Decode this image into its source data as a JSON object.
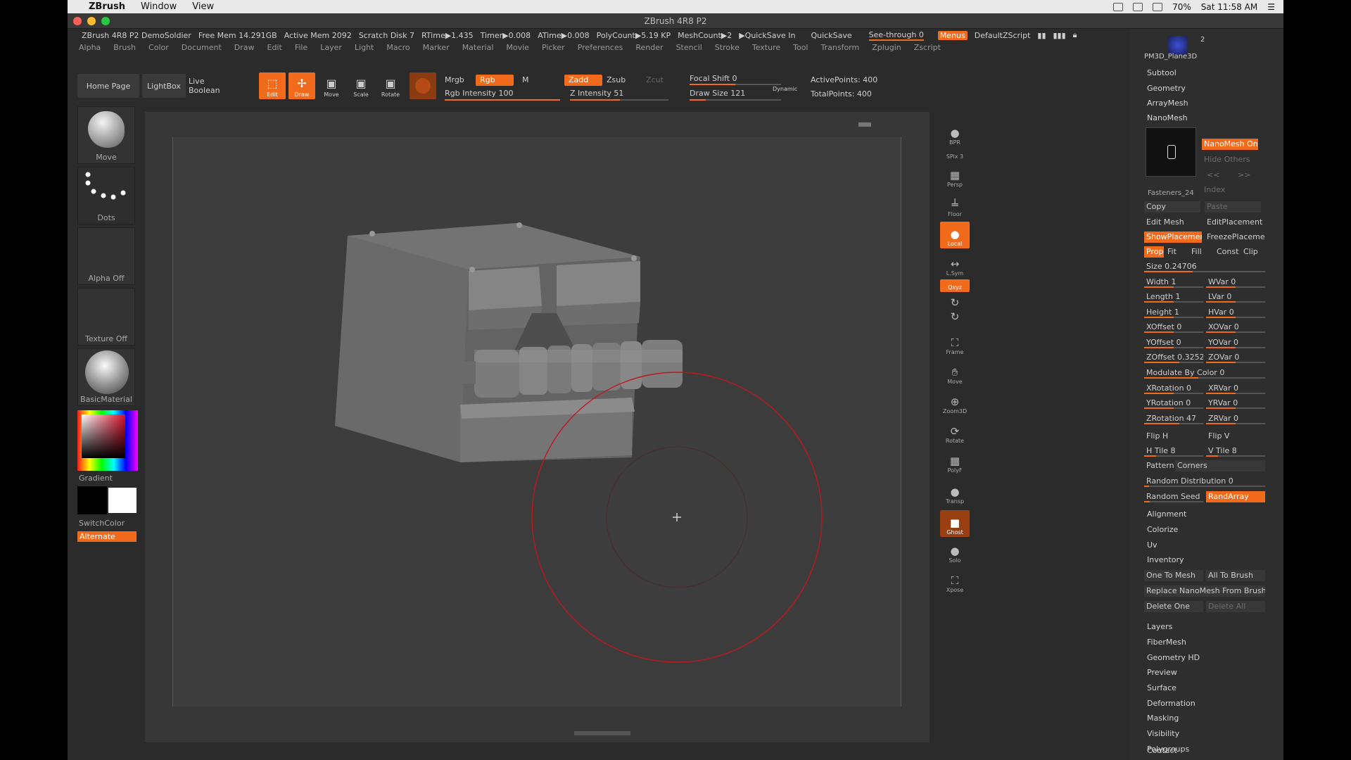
{
  "mac_menu": {
    "app": "ZBrush",
    "items": [
      "Window",
      "View"
    ],
    "battery": "70%",
    "clock": "Sat 11:58 AM"
  },
  "window": {
    "title": "ZBrush 4R8 P2"
  },
  "status": {
    "product": "ZBrush 4R8 P2 DemoSoldier",
    "free_mem": "Free Mem 14.291GB",
    "active_mem": "Active Mem 2092",
    "scratch": "Scratch Disk 7",
    "rtime": "RTime▶1.435",
    "timer": "Timer▶0.008",
    "atime": "ATime▶0.008",
    "polycount": "PolyCount▶5.19 KP",
    "meshcount": "MeshCount▶2",
    "quicksave_in": "▶QuickSave In",
    "quicksave": "QuickSave",
    "see_through": "See-through  0",
    "menus": "Menus",
    "script": "DefaultZScript"
  },
  "menus": [
    "Alpha",
    "Brush",
    "Color",
    "Document",
    "Draw",
    "Edit",
    "File",
    "Layer",
    "Light",
    "Macro",
    "Marker",
    "Material",
    "Movie",
    "Picker",
    "Preferences",
    "Render",
    "Stencil",
    "Stroke",
    "Texture",
    "Tool",
    "Transform",
    "Zplugin",
    "Zscript"
  ],
  "toolbar": {
    "home_page": "Home Page",
    "lightbox": "LightBox",
    "live_boolean": "Live Boolean",
    "edit": "Edit",
    "draw": "Draw",
    "move": "Move",
    "scale": "Scale",
    "rotate": "Rotate",
    "mrgb": "Mrgb",
    "rgb": "Rgb",
    "m": "M",
    "rgb_intensity": "Rgb Intensity 100",
    "zadd": "Zadd",
    "zsub": "Zsub",
    "zcut": "Zcut",
    "z_intensity": "Z Intensity 51",
    "focal_shift": "Focal Shift 0",
    "draw_size": "Draw Size 121",
    "dynamic": "Dynamic",
    "active_points": "ActivePoints: 400",
    "total_points": "TotalPoints: 400"
  },
  "shelf": {
    "move": "Move",
    "dots": "Dots",
    "alpha_off": "Alpha Off",
    "texture_off": "Texture Off",
    "material": "BasicMaterial",
    "gradient": "Gradient",
    "switch_color": "SwitchColor",
    "alternate": "Alternate"
  },
  "strip": {
    "bpr": "BPR",
    "spix": "SPix 3",
    "persp": "Persp",
    "floor": "Floor",
    "local": "Local",
    "lsym": "L.Sym",
    "xyz": "Qxyz",
    "frame": "Frame",
    "move": "Move",
    "zoom3d": "Zoom3D",
    "rotate": "Rotate",
    "polyf": "PolyF",
    "transp": "Transp",
    "ghost": "Ghost",
    "solo": "Solo",
    "xpose": "Xpose"
  },
  "right_panel": {
    "tool_name": "PM3D_Plane3D",
    "tool_count": "2",
    "subtool": "Subtool",
    "geometry": "Geometry",
    "arraymesh": "ArrayMesh",
    "nanomesh": "NanoMesh",
    "nanomesh_on": "NanoMesh On",
    "hide_others": "Hide Others",
    "prev": "<<",
    "next": ">>",
    "index": "Index",
    "fasteners": "Fasteners_24",
    "copy": "Copy",
    "paste": "Paste",
    "edit_mesh": "Edit Mesh",
    "edit_placement": "EditPlacement",
    "show_placement": "ShowPlacement",
    "freeze_placement": "FreezePlacement",
    "prop": "Prop",
    "fit": "Fit",
    "fill": "Fill",
    "const": "Const",
    "clip": "Clip",
    "size": "Size 0.24706",
    "width": "Width 1",
    "wvar": "WVar 0",
    "length": "Length 1",
    "lvar": "LVar 0",
    "height": "Height 1",
    "hvar": "HVar 0",
    "xoffset": "XOffset 0",
    "xovar": "XOVar 0",
    "yoffset": "YOffset 0",
    "yovar": "YOVar 0",
    "zoffset": "ZOffset 0.3252",
    "zovar": "ZOVar 0",
    "modulate": "Modulate By Color 0",
    "xrotation": "XRotation 0",
    "xrvar": "XRVar 0",
    "yrotation": "YRotation 0",
    "yrvar": "YRVar 0",
    "zrotation": "ZRotation 47",
    "zrvar": "ZRVar 0",
    "flip_h": "Flip H",
    "flip_v": "Flip V",
    "h_tile": "H Tile 8",
    "v_tile": "V Tile 8",
    "pattern": "Pattern",
    "corners": "Corners",
    "random_dist": "Random Distribution 0",
    "random_seed": "Random Seed",
    "randarray": "RandArray",
    "alignment": "Alignment",
    "colorize": "Colorize",
    "uv": "Uv",
    "inventory": "Inventory",
    "one_to_mesh": "One To Mesh",
    "all_to_brush": "All To Brush",
    "replace": "Replace NanoMesh From Brush",
    "delete_one": "Delete One",
    "delete_all": "Delete All",
    "layers": "Layers",
    "fibermesh": "FiberMesh",
    "geometry_hd": "Geometry HD",
    "preview": "Preview",
    "surface": "Surface",
    "deformation": "Deformation",
    "masking": "Masking",
    "visibility": "Visibility",
    "polygroups": "Polygroups",
    "contact": "Contact"
  },
  "colors": {
    "accent": "#f26b1d",
    "panel": "#2e2e2e",
    "canvas": "#3d3d3d",
    "brush_ring": "#c0181c"
  }
}
